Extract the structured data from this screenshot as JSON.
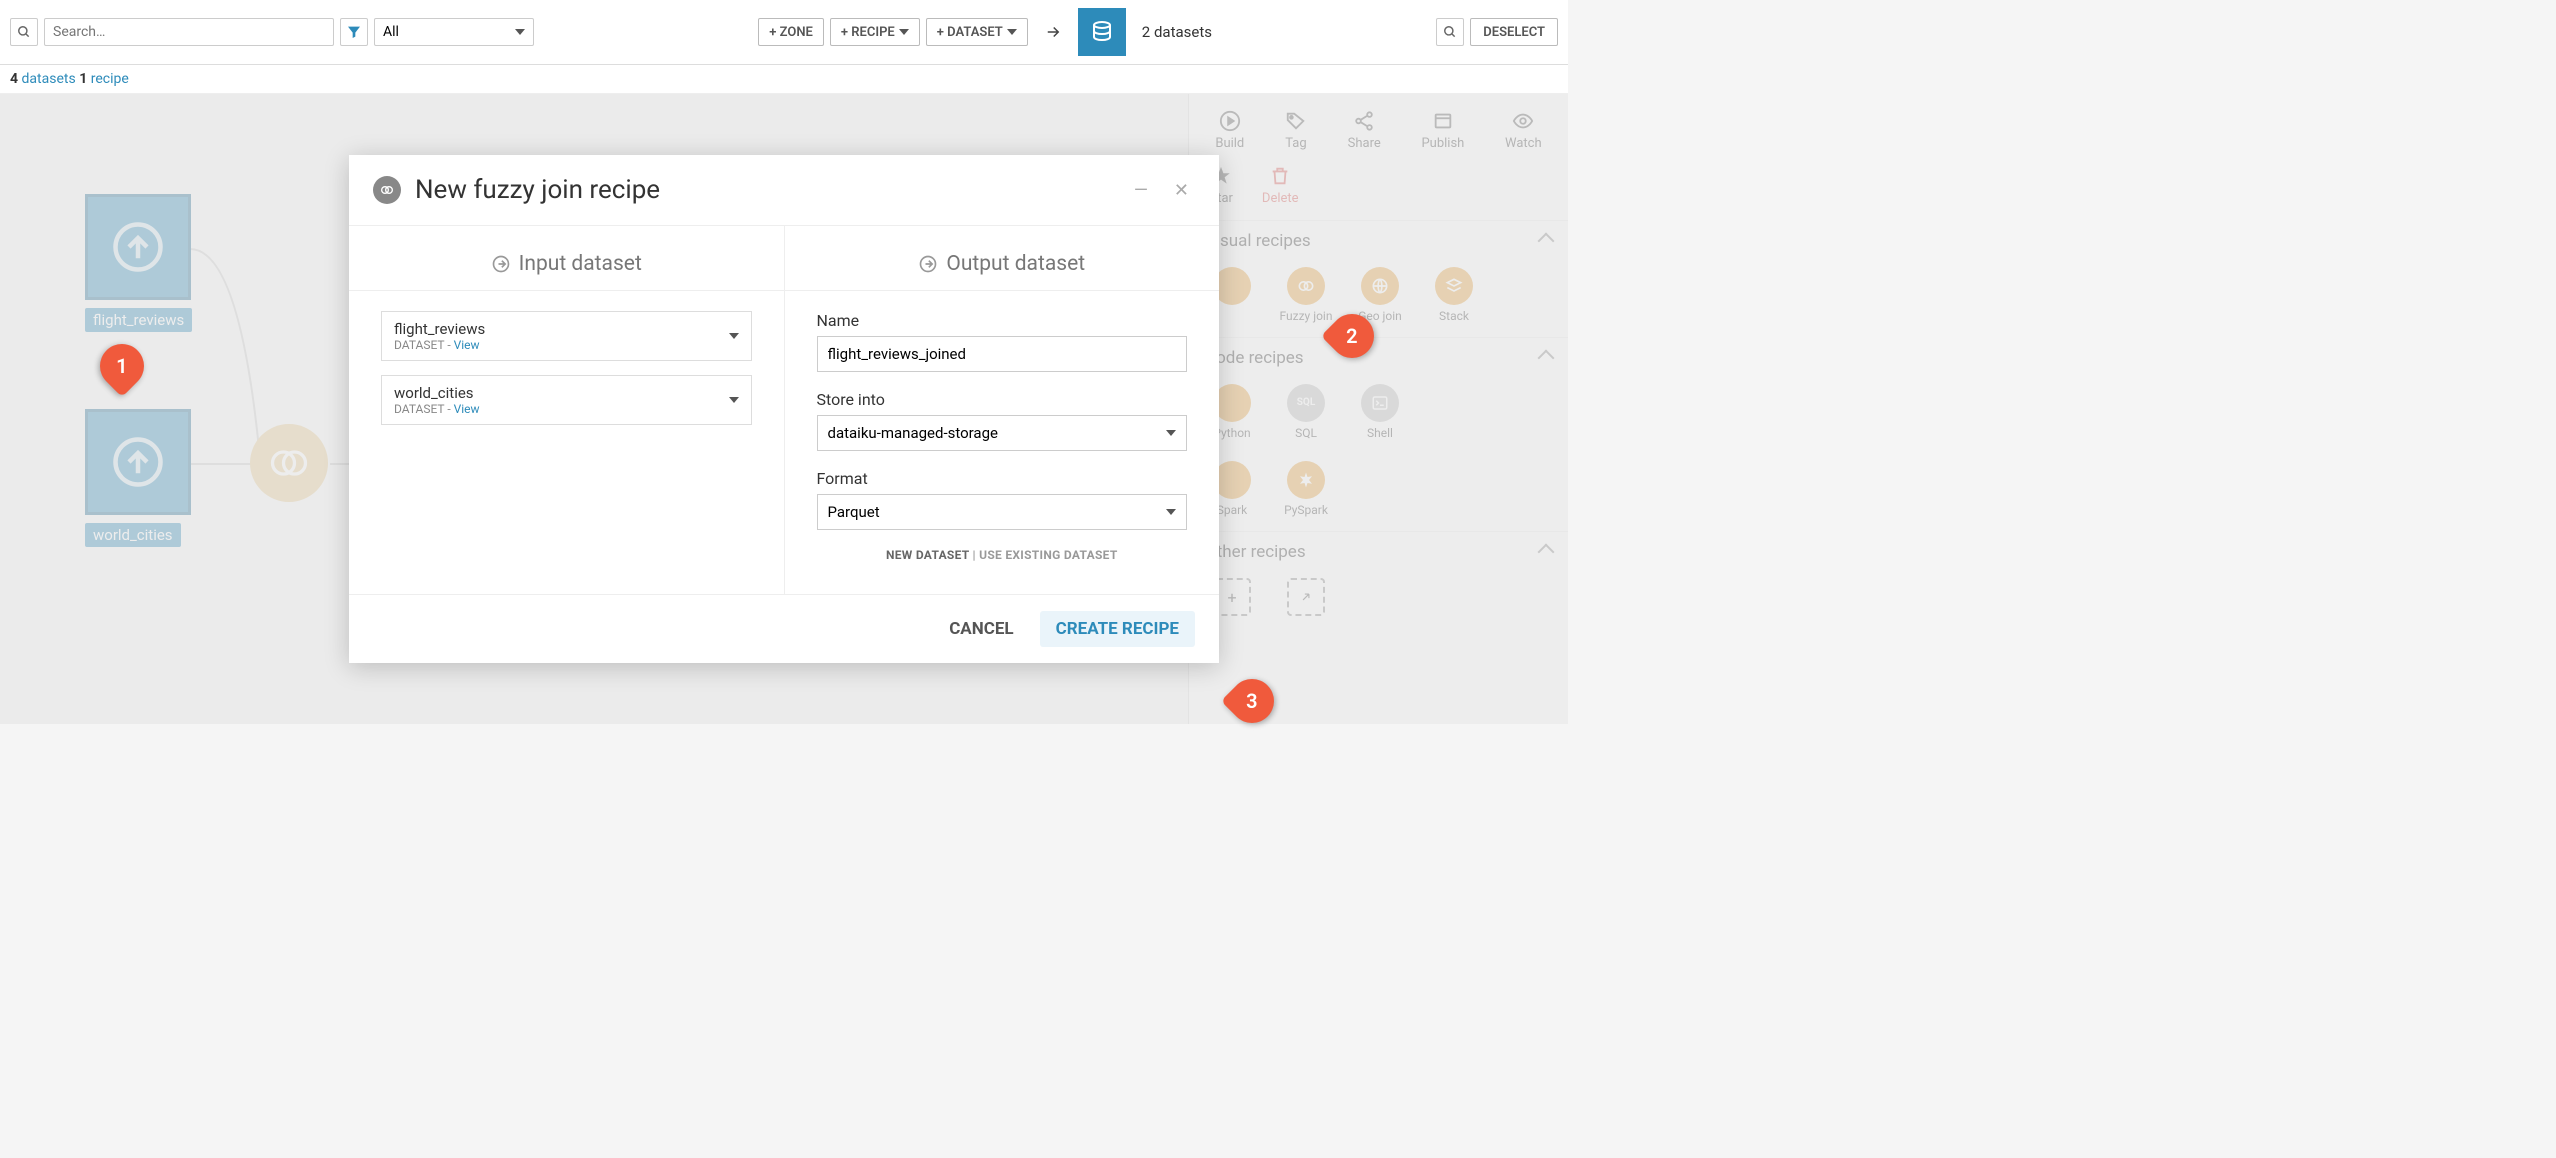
{
  "toolbar": {
    "search_placeholder": "Search…",
    "filter_label": "All",
    "zone_btn": "+ ZONE",
    "recipe_btn": "+ RECIPE",
    "dataset_btn": "+ DATASET",
    "datasets_count": "2 datasets",
    "deselect": "DESELECT"
  },
  "breadcrumb": {
    "n1": "4",
    "t1": "datasets",
    "n2": "1",
    "t2": "recipe"
  },
  "flow": {
    "ds1": "flight_reviews",
    "ds2": "world_cities"
  },
  "panel": {
    "actions": {
      "build": "Build",
      "tag": "Tag",
      "share": "Share",
      "publish": "Publish",
      "watch": "Watch",
      "star": "Star",
      "delete": "Delete"
    },
    "sections": {
      "visual": "Visual recipes",
      "code": "Code recipes",
      "other": "Other recipes"
    },
    "recipes": {
      "fuzzy": "Fuzzy join",
      "geo": "Geo join",
      "stack": "Stack",
      "python": "Python",
      "sql": "SQL",
      "shell": "Shell",
      "spark": "Spark",
      "pyspark": "PySpark"
    }
  },
  "modal": {
    "title": "New fuzzy join recipe",
    "input_head": "Input dataset",
    "output_head": "Output dataset",
    "inputs": [
      {
        "name": "flight_reviews",
        "type": "DATASET",
        "view": "View"
      },
      {
        "name": "world_cities",
        "type": "DATASET",
        "view": "View"
      }
    ],
    "name_label": "Name",
    "name_value": "flight_reviews_joined",
    "store_label": "Store into",
    "store_value": "dataiku-managed-storage",
    "format_label": "Format",
    "format_value": "Parquet",
    "toggle_new": "NEW DATASET",
    "toggle_sep": " | ",
    "toggle_existing": "USE EXISTING DATASET",
    "cancel": "CANCEL",
    "create": "CREATE RECIPE"
  },
  "callouts": {
    "c1": "1",
    "c2": "2",
    "c3": "3"
  }
}
